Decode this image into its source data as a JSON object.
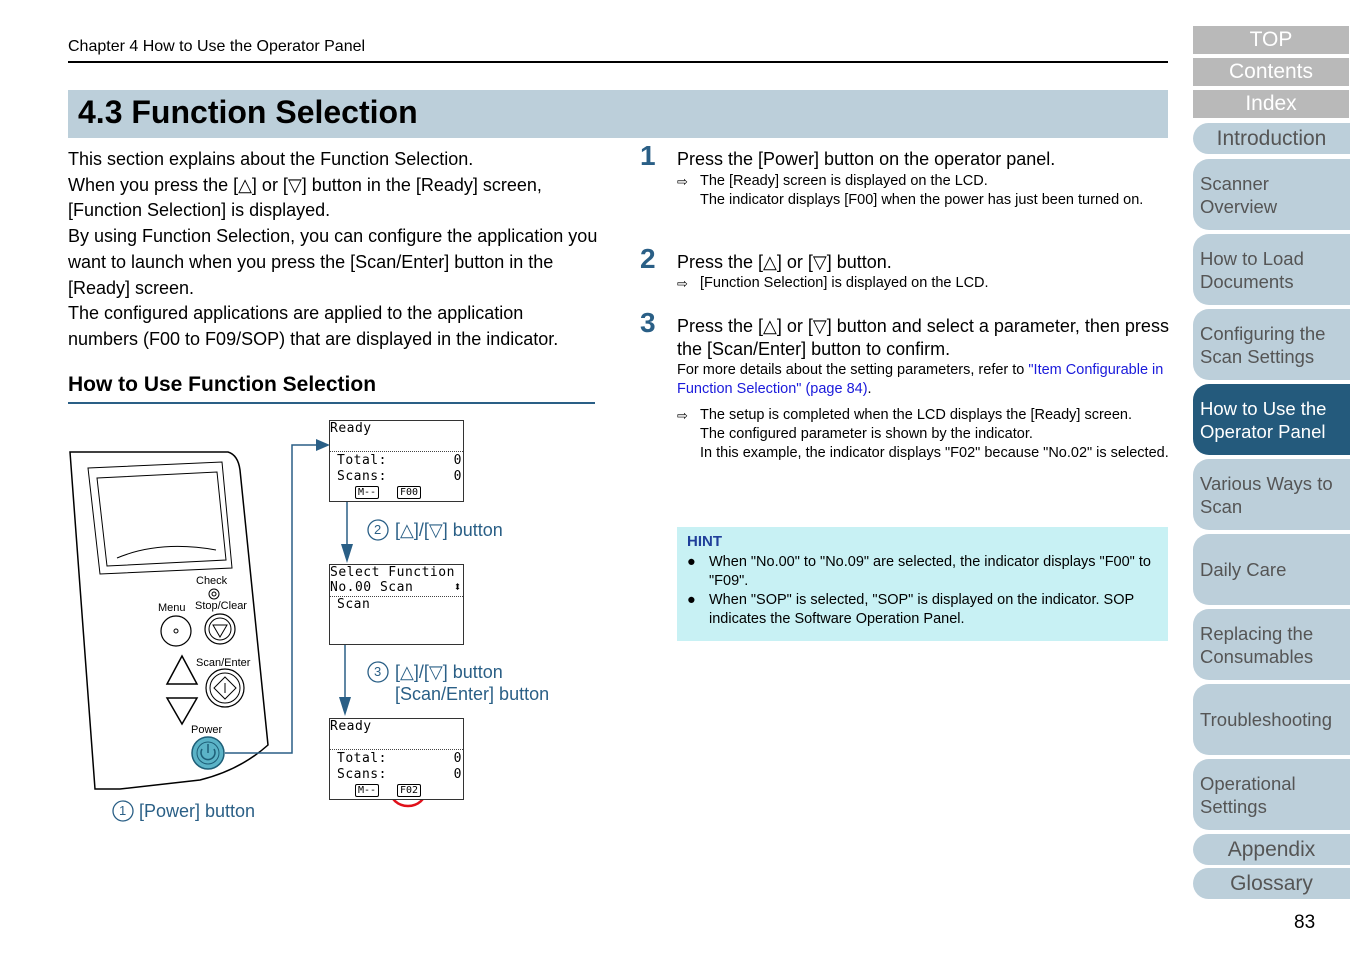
{
  "header": {
    "chapter": "Chapter 4 How to Use the Operator Panel",
    "section_title": "4.3 Function Selection"
  },
  "intro": {
    "paragraphs": [
      "This section explains about the Function Selection.",
      "When you press the [△] or [▽] button in the [Ready] screen, [Function Selection] is displayed.",
      "By using Function Selection, you can configure the application you want to launch when you press the [Scan/Enter] button in the [Ready] screen.",
      "The configured applications are applied to the application numbers (F00 to F09/SOP) that are displayed in the indicator."
    ]
  },
  "subheading": "How to Use Function Selection",
  "diagram": {
    "panel_labels": {
      "check": "Check",
      "menu": "Menu",
      "stop_clear": "Stop/Clear",
      "scan_enter": "Scan/Enter",
      "power": "Power"
    },
    "callouts": {
      "c1_num": "1",
      "c1_text": "[Power] button",
      "c2_num": "2",
      "c2_text": "[△]/[▽] button",
      "c3_num": "3",
      "c3_line1": "[△]/[▽] button",
      "c3_line2": "[Scan/Enter] button"
    },
    "lcd1": {
      "title": "Ready",
      "total_label": "Total:",
      "total_val": "0",
      "scans_label": "Scans:",
      "scans_val": "0",
      "mode_tag": "M--",
      "func_tag": "F00"
    },
    "lcd2": {
      "line1": "Select Function",
      "line2": "No.00 Scan",
      "line3": "Scan",
      "updown_glyph": "⬍"
    },
    "lcd3": {
      "title": "Ready",
      "total_label": "Total:",
      "total_val": "0",
      "scans_label": "Scans:",
      "scans_val": "0",
      "mode_tag": "M--",
      "func_tag": "F02"
    },
    "highlight_color": "#e0101a",
    "accent_color": "#2a5f86"
  },
  "steps": [
    {
      "number": "1",
      "text": "Press the [Power] button on the operator panel.",
      "results": [
        "The [Ready] screen is displayed on the LCD.\nThe indicator displays [F00] when the power has just been turned on."
      ]
    },
    {
      "number": "2",
      "text": "Press the [△] or [▽] button.",
      "results": [
        "[Function Selection] is displayed on the LCD."
      ]
    },
    {
      "number": "3",
      "text": "Press the [△] or [▽] button and select a parameter, then press the [Scan/Enter] button to confirm.",
      "note_prefix": "For more details about the setting parameters, refer to ",
      "note_link": "\"Item Configurable in Function Selection\" (page 84)",
      "note_suffix": ".",
      "results": [
        "The setup is completed when the LCD displays the [Ready] screen.\nThe configured parameter is shown by the indicator.\nIn this example, the indicator displays \"F02\" because \"No.02\" is selected."
      ]
    }
  ],
  "result_arrow": "⇨",
  "hint": {
    "title": "HINT",
    "bullet": "●",
    "items": [
      "When \"No.00\" to \"No.09\" are selected, the indicator displays \"F00\" to \"F09\".",
      "When \"SOP\" is selected, \"SOP\" is displayed on the indicator. SOP indicates the Software Operation Panel."
    ]
  },
  "side_nav": {
    "top_buttons": [
      "TOP",
      "Contents",
      "Index"
    ],
    "tabs": [
      {
        "label": "Introduction",
        "active": false
      },
      {
        "label": "Scanner Overview",
        "active": false
      },
      {
        "label": "How to Load Documents",
        "active": false
      },
      {
        "label": "Configuring the Scan Settings",
        "active": false
      },
      {
        "label": "How to Use the Operator Panel",
        "active": true
      },
      {
        "label": "Various Ways to Scan",
        "active": false
      },
      {
        "label": "Daily Care",
        "active": false
      },
      {
        "label": "Replacing the Consumables",
        "active": false
      },
      {
        "label": "Troubleshooting",
        "active": false
      },
      {
        "label": "Operational Settings",
        "active": false
      },
      {
        "label": "Appendix",
        "active": false
      },
      {
        "label": "Glossary",
        "active": false
      }
    ]
  },
  "page_number": "83"
}
